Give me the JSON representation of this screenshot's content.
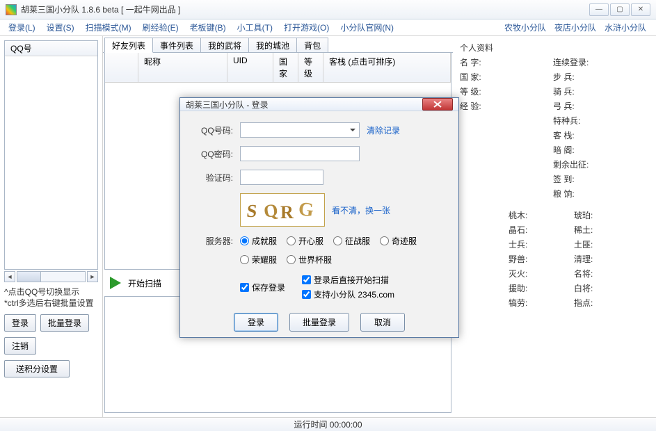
{
  "window": {
    "title": "胡莱三国小分队 1.8.6 beta [ 一起牛网出品 ]"
  },
  "menu": {
    "left": [
      "登录(L)",
      "设置(S)",
      "扫描模式(M)",
      "刷经验(E)",
      "老板键(B)",
      "小工具(T)",
      "打开游戏(O)",
      "小分队官网(N)"
    ],
    "right": [
      "农牧小分队",
      "夜店小分队",
      "水浒小分队"
    ]
  },
  "left": {
    "qq_header": "QQ号",
    "tip1": "^点击QQ号切换显示",
    "tip2": "*ctrl多选后右键批量设置",
    "btn_login": "登录",
    "btn_batch": "批量登录",
    "btn_logout": "注销",
    "btn_points": "送积分设置"
  },
  "tabs": [
    "好友列表",
    "事件列表",
    "我的武将",
    "我的城池",
    "背包"
  ],
  "columns": {
    "c0": "",
    "c1": "昵称",
    "c2": "UID",
    "c3": "国家",
    "c4": "等级",
    "c5": "客栈 (点击可排序)"
  },
  "scan": {
    "label": "开始扫描"
  },
  "profile": {
    "title": "个人资料",
    "l": [
      "名 字:",
      "国 家:",
      "等 级:",
      "经 验:"
    ],
    "r": [
      "连续登录:",
      "步 兵:",
      "骑 兵:",
      "弓 兵:",
      "特种兵:",
      "客 栈:",
      "暗 阁:",
      "剩余出征:",
      "签 到:",
      "粮 饷:"
    ],
    "bl": [
      "桃木:",
      "晶石:",
      "士兵:",
      "野兽:",
      "灭火:",
      "援助:",
      "犒劳:"
    ],
    "br": [
      "琥珀:",
      "稀土:",
      "土匪:",
      "清理:",
      "名将:",
      "白将:",
      "指点:"
    ]
  },
  "status": {
    "label": "运行时间 00:00:00"
  },
  "dialog": {
    "title": "胡莱三国小分队 - 登录",
    "qq_label": "QQ号码:",
    "clear": "清除记录",
    "pwd_label": "QQ密码:",
    "captcha_label": "验证码:",
    "refresh": "看不清，换一张",
    "server_label": "服务器:",
    "servers": [
      "成就服",
      "开心服",
      "征战服",
      "奇迹服",
      "荣耀服",
      "世界杯服"
    ],
    "save_login": "保存登录",
    "auto_scan": "登录后直接开始扫描",
    "support": "支持小分队 2345.com",
    "btn_login": "登录",
    "btn_batch": "批量登录",
    "btn_cancel": "取消"
  }
}
